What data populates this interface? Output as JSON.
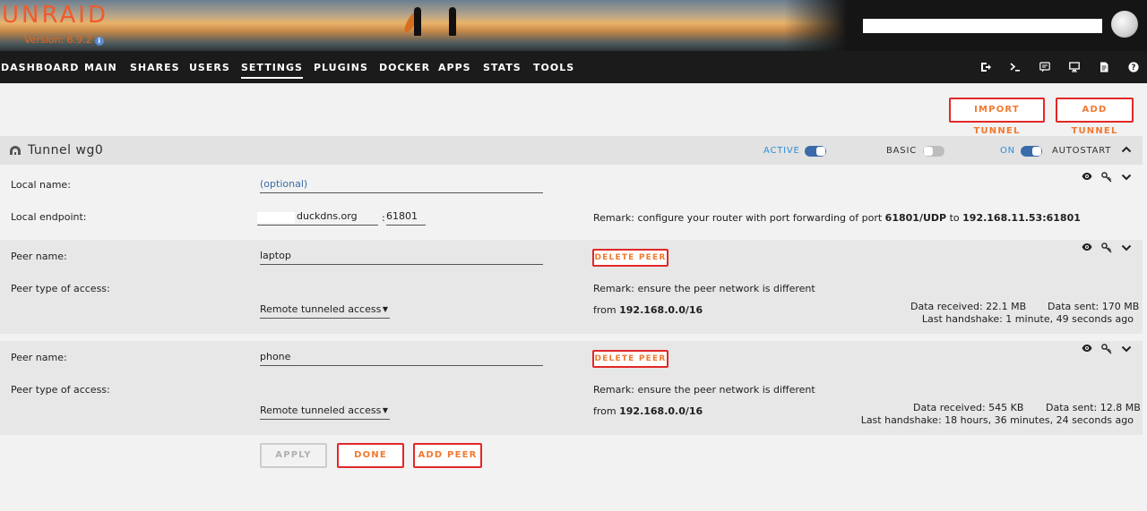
{
  "header": {
    "logo": "UNRAID",
    "version": "Version: 6.9.2"
  },
  "nav": {
    "items": [
      "DASHBOARD",
      "MAIN",
      "SHARES",
      "USERS",
      "SETTINGS",
      "PLUGINS",
      "DOCKER",
      "APPS",
      "STATS",
      "TOOLS"
    ],
    "active": "SETTINGS",
    "icons": [
      "logout-icon",
      "terminal-icon",
      "log-icon",
      "monitor-icon",
      "notes-icon",
      "help-icon"
    ]
  },
  "actions": {
    "import_tunnel": "IMPORT TUNNEL",
    "add_tunnel": "ADD TUNNEL"
  },
  "tunnel": {
    "name": "Tunnel wg0",
    "active_label": "ACTIVE",
    "active": true,
    "basic_label": "BASIC",
    "basic": false,
    "on_label": "ON",
    "autostart_label": "AUTOSTART",
    "autostart": true,
    "local_name_label": "Local name:",
    "local_name_placeholder": "(optional)",
    "local_endpoint_label": "Local endpoint:",
    "endpoint_host": "duckdns.org",
    "endpoint_sep": ":",
    "endpoint_port": "61801",
    "remark_prefix": "Remark: configure your router with port forwarding of port",
    "remark_port": "61801/UDP",
    "remark_to": "to",
    "remark_target": "192.168.11.53:61801"
  },
  "peers": [
    {
      "name_label": "Peer name:",
      "name": "laptop",
      "delete_label": "DELETE PEER",
      "type_label": "Peer type of access:",
      "type_value": "Remote tunneled access",
      "remark": "Remark: ensure the peer network is different",
      "from_prefix": "from",
      "from_network": "192.168.0.0/16",
      "data_received": "Data received: 22.1 MB",
      "data_sent": "Data sent: 170 MB",
      "last_handshake": "Last handshake: 1 minute, 49 seconds ago"
    },
    {
      "name_label": "Peer name:",
      "name": "phone",
      "delete_label": "DELETE PEER",
      "type_label": "Peer type of access:",
      "type_value": "Remote tunneled access",
      "remark": "Remark: ensure the peer network is different",
      "from_prefix": "from",
      "from_network": "192.168.0.0/16",
      "data_received": "Data received: 545 KB",
      "data_sent": "Data sent: 12.8 MB",
      "last_handshake": "Last handshake: 18 hours, 36 minutes, 24 seconds ago"
    }
  ],
  "footer": {
    "apply": "APPLY",
    "done": "DONE",
    "add_peer": "ADD PEER"
  },
  "colors": {
    "accent": "#f2792f",
    "border_red": "#e22828",
    "switch_blue": "#3b6aa8",
    "nav_bg": "#1b1b1b"
  }
}
